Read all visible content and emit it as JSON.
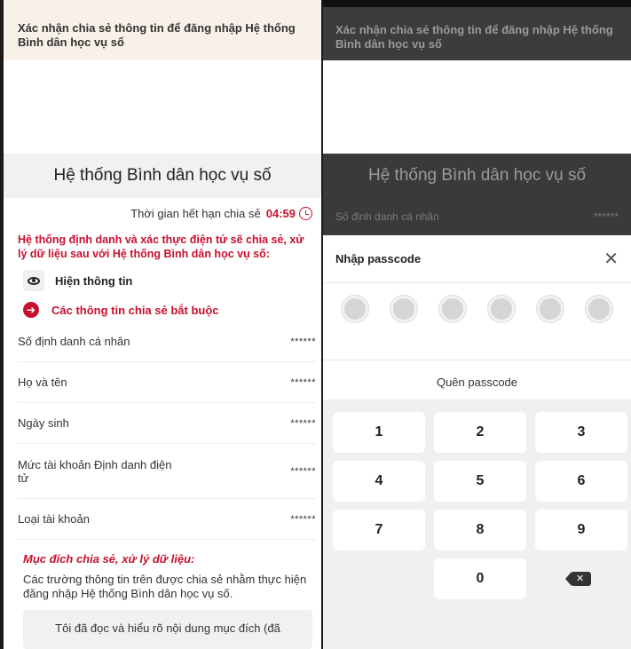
{
  "left": {
    "banner_title": "Xác nhận chia sẻ thông tin để đăng nhập Hệ thống Bình dân học vụ số",
    "system_name": "Hệ thống Bình dân học vụ số",
    "expire_label": "Thời gian hết hạn chia sẻ",
    "expire_time": "04:59",
    "warning": "Hệ thống định danh và xác thực điện tử sẽ chia sẻ, xử lý dữ liệu sau với Hệ thống Bình dân học vụ số:",
    "show_info_label": "Hiện thông tin",
    "required_label": "Các thông tin chia sẻ bắt buộc",
    "fields": [
      {
        "label": "Số định danh cá nhân",
        "value": "******"
      },
      {
        "label": "Họ và tên",
        "value": "******"
      },
      {
        "label": "Ngày sinh",
        "value": "******"
      },
      {
        "label": "Mức tài khoản Định danh điện tử",
        "value": "******"
      },
      {
        "label": "Loại tài khoản",
        "value": "******"
      }
    ],
    "purpose_title": "Mục đích chia sẻ, xử lý dữ liệu:",
    "purpose_text": "Các trường thông tin trên được chia sẻ nhằm thực hiện đăng nhập Hệ thống Bình dân học vụ số.",
    "ack_text": "Tôi đã đọc và hiểu rõ nội dung mục đích (đã"
  },
  "right": {
    "banner_title": "Xác nhận chia sẻ thông tin để đăng nhập Hệ thống Bình dân học vụ số",
    "system_name": "Hệ thống Bình dân học vụ số",
    "dim_field_label": "Số định danh cá nhân",
    "dim_field_value": "******",
    "sheet_title": "Nhập passcode",
    "forgot_label": "Quên passcode",
    "keys": [
      "1",
      "2",
      "3",
      "4",
      "5",
      "6",
      "7",
      "8",
      "9",
      "0"
    ]
  }
}
